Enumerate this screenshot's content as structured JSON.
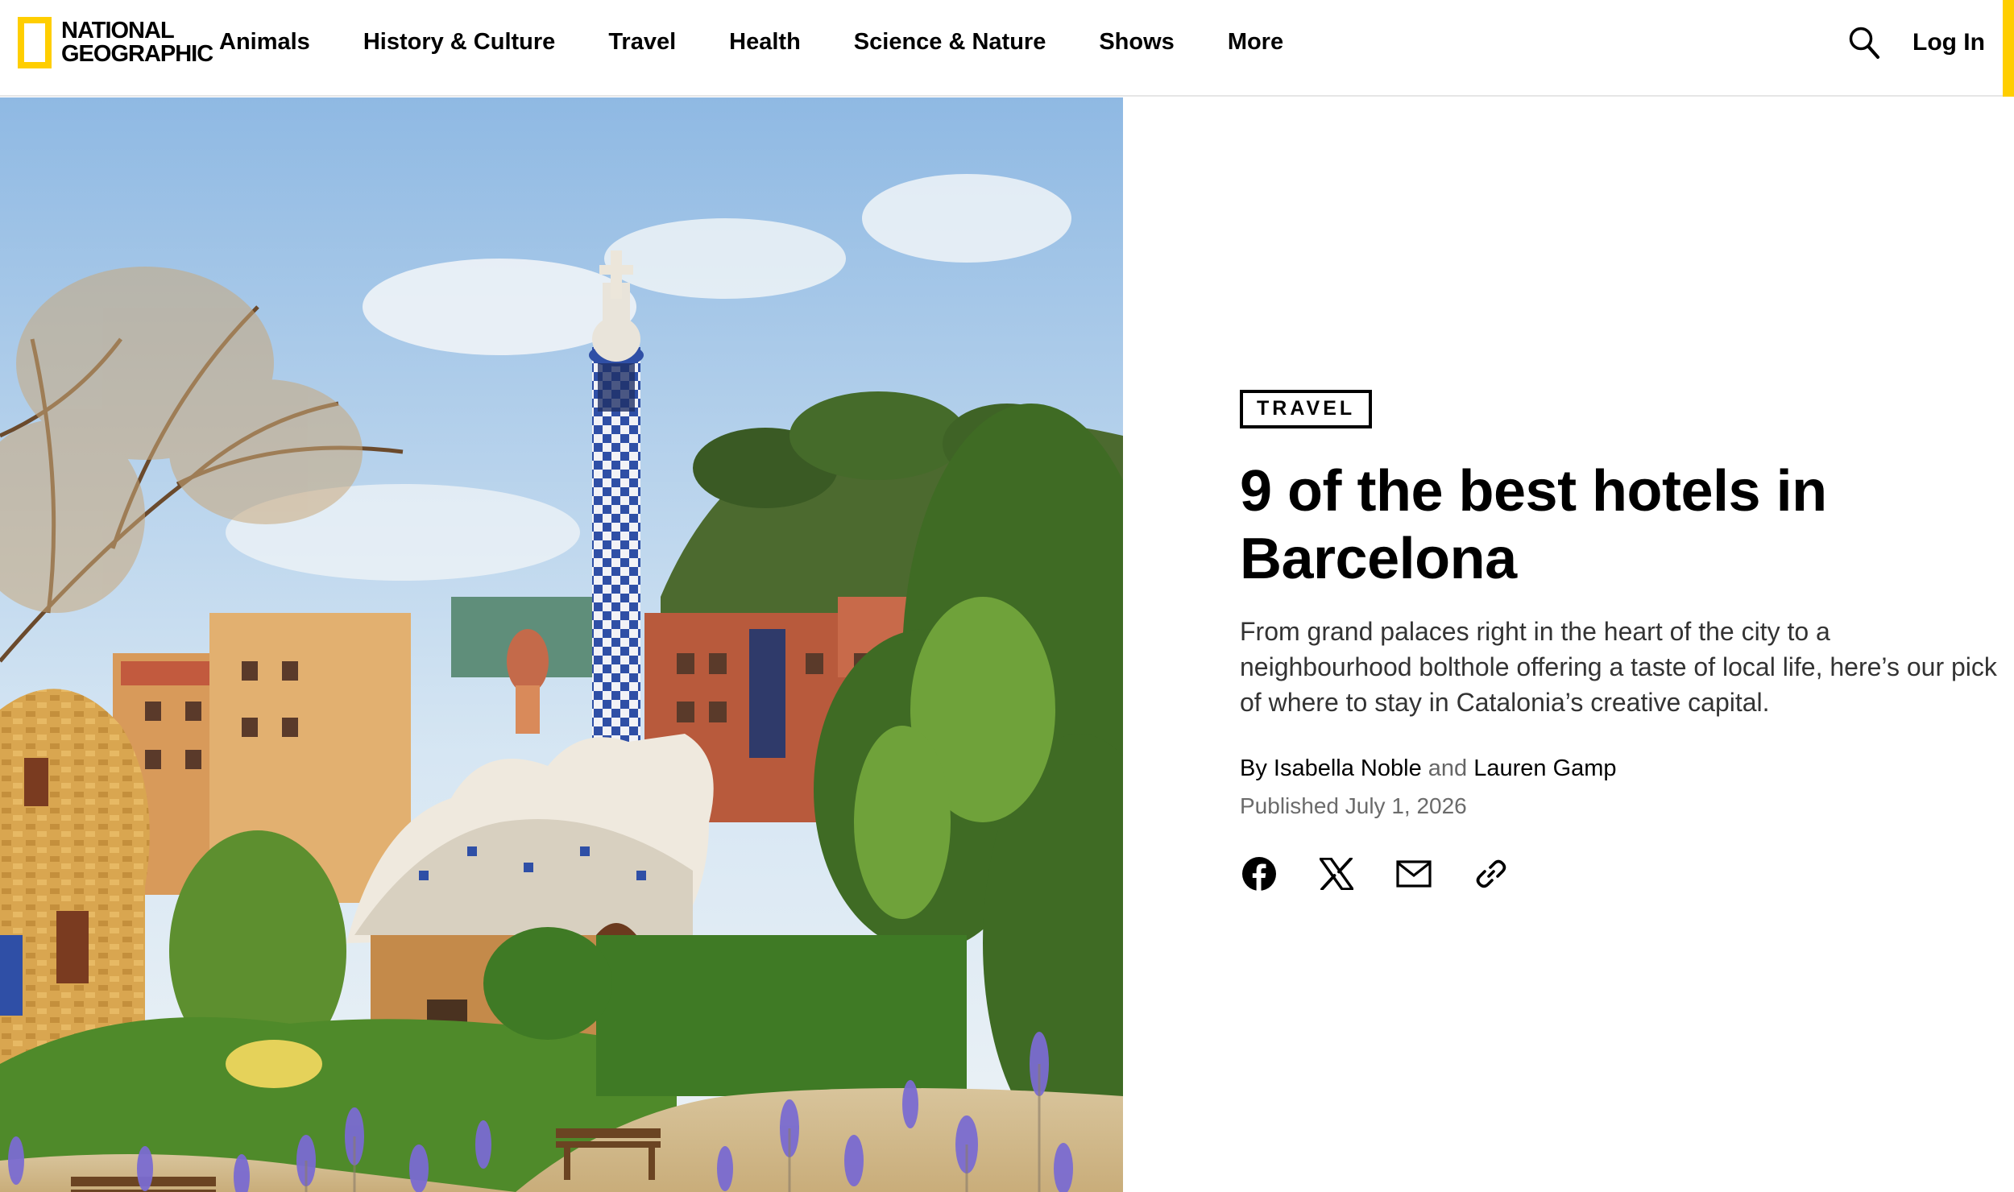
{
  "header": {
    "logo": {
      "line1": "NATIONAL",
      "line2": "GEOGRAPHIC",
      "frame_color": "#ffce00"
    },
    "nav": [
      {
        "label": "Animals"
      },
      {
        "label": "History & Culture"
      },
      {
        "label": "Travel"
      },
      {
        "label": "Health"
      },
      {
        "label": "Science & Nature"
      },
      {
        "label": "Shows"
      },
      {
        "label": "More"
      }
    ],
    "search_icon": "search-icon",
    "login_label": "Log In",
    "accent_color": "#ffce00"
  },
  "article": {
    "tag": "TRAVEL",
    "title": "9 of the best hotels in Barcelona",
    "dek": "From grand palaces right in the heart of the city to a neighbourhood bolthole offering a taste of local life, here’s our pick of where to stay in Catalonia’s creative capital.",
    "byline": {
      "prefix": "By",
      "author1": "Isabella Noble",
      "conjunction": "and",
      "author2": "Lauren Gamp"
    },
    "published": "Published July 1, 2026",
    "share": [
      {
        "icon": "facebook-icon"
      },
      {
        "icon": "x-icon"
      },
      {
        "icon": "email-icon"
      },
      {
        "icon": "link-icon"
      }
    ]
  }
}
